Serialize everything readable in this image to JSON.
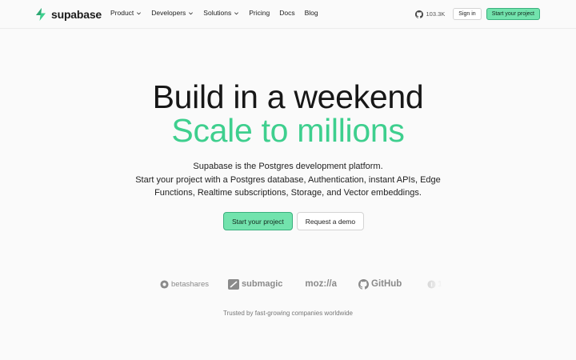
{
  "nav": {
    "brand": "supabase",
    "links": [
      {
        "label": "Product",
        "dropdown": true
      },
      {
        "label": "Developers",
        "dropdown": true
      },
      {
        "label": "Solutions",
        "dropdown": true
      },
      {
        "label": "Pricing",
        "dropdown": false
      },
      {
        "label": "Docs",
        "dropdown": false
      },
      {
        "label": "Blog",
        "dropdown": false
      }
    ],
    "github_stars": "103.3K",
    "sign_in": "Sign in",
    "start_project": "Start your project"
  },
  "hero": {
    "title_line1": "Build in a weekend",
    "title_line2": "Scale to millions",
    "description_line1": "Supabase is the Postgres development platform.",
    "description_line2": "Start your project with a Postgres database, Authentication, instant APIs, Edge",
    "description_line3": "Functions, Realtime subscriptions, Storage, and Vector embeddings.",
    "primary_cta": "Start your project",
    "secondary_cta": "Request a demo"
  },
  "logos": {
    "brands": [
      "betashares",
      "submagic",
      "moz://a",
      "GitHub",
      "1P"
    ],
    "caption": "Trusted by fast-growing companies worldwide"
  },
  "colors": {
    "brand_green": "#3ecf8e",
    "button_green": "#72e3ad",
    "background": "#fafafa"
  }
}
